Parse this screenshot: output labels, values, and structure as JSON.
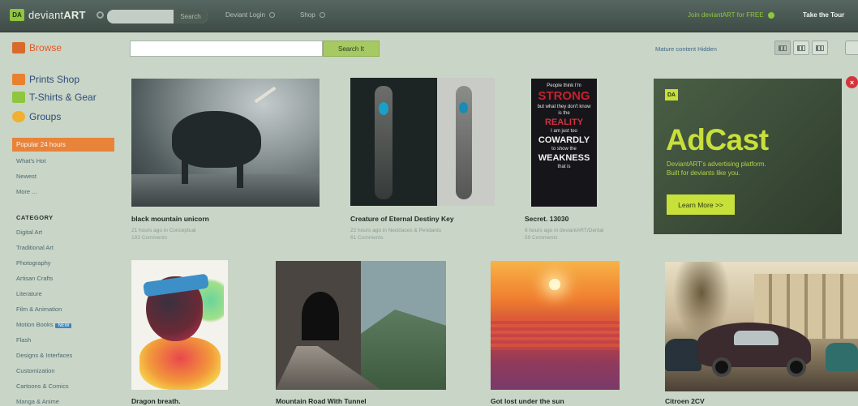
{
  "topbar": {
    "logo_badge": "DA",
    "logo_text_main": "deviant",
    "logo_text_bold": "ART",
    "search_button": "Search",
    "links": [
      "Deviant Login",
      "Shop"
    ],
    "join_text": "Join deviantART for FREE",
    "tour_text": "Take the Tour"
  },
  "sidebar": {
    "browse": "Browse",
    "main_items": [
      "Prints Shop",
      "T-Shirts & Gear",
      "Groups"
    ],
    "filters_active": "Popular 24 hours",
    "filters": [
      "What's Hot",
      "Newest",
      "More ..."
    ],
    "category_header": "CATEGORY",
    "categories": [
      "Digital Art",
      "Traditional Art",
      "Photography",
      "Artisan Crafts",
      "Literature",
      "Film & Animation",
      "Motion Books",
      "Flash",
      "Designs & Interfaces",
      "Customization",
      "Cartoons & Comics",
      "Manga & Anime"
    ],
    "new_badge": "NEW"
  },
  "browse": {
    "search_button": "Search It",
    "mature_link": "Mature content Hidden"
  },
  "deviations": [
    {
      "title": "black mountain unicorn",
      "meta": "21 hours ago in Conceptual",
      "comments": "183 Comments"
    },
    {
      "title": "Creature of Eternal Destiny Key",
      "meta": "22 hours ago in Necklaces & Pendants",
      "comments": "61 Comments"
    },
    {
      "title": "Secret. 13030",
      "meta": "6 hours ago in deviantART/Dental",
      "comments": "59 Comments"
    },
    {
      "title": "Dragon breath."
    },
    {
      "title": "Mountain Road With Tunnel"
    },
    {
      "title": "Got lost under the sun"
    },
    {
      "title": "Citroen 2CV"
    }
  ],
  "secret_art": {
    "line1": "People think I'm",
    "line2": "STRONG",
    "line3": "but what they don't know",
    "line4": "is the",
    "line5": "REALITY",
    "line6": "I am just too",
    "line7": "COWARDLY",
    "line8": "to show the",
    "line9": "WEAKNESS",
    "line10": "that is"
  },
  "ad": {
    "badge": "DA",
    "title": "AdCast",
    "subtitle_1": "DeviantART's advertising platform.",
    "subtitle_2": "Built for deviants like you.",
    "button": "Learn More >>",
    "close": "×"
  },
  "colors": {
    "accent_orange": "#e8833a",
    "brand_green": "#8ec63f",
    "ad_green": "#c8e03a"
  }
}
